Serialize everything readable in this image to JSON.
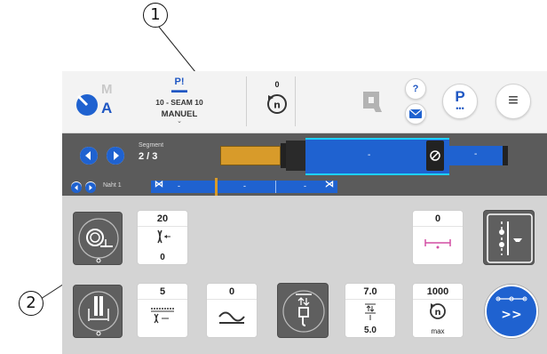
{
  "callouts": {
    "one": "1",
    "two": "2"
  },
  "header": {
    "mode_logo": {
      "big_letter": "A",
      "small_letter": "M"
    },
    "program": {
      "icon_label": "P!",
      "name": "10 - SEAM 10",
      "mode": "MANUEL"
    },
    "counter_value": "0",
    "help_label": "?",
    "p_label": "P",
    "menu_label": "≡"
  },
  "segment_bar": {
    "segment_label": "Segment",
    "segment_value": "2 / 3",
    "seam_label": "Naht 1",
    "segment_dash": "-",
    "right_dash": "-",
    "seam_cells": [
      "-",
      "-",
      "-"
    ]
  },
  "functions": {
    "row1": {
      "tile_a": {
        "top": "20",
        "bottom": "0"
      },
      "tile_b": {
        "top": "0"
      }
    },
    "row2": {
      "tile_c": {
        "top": "5"
      },
      "tile_d": {
        "top": "0"
      },
      "tile_e": {
        "top": "7.0",
        "bottom": "5.0"
      },
      "tile_f": {
        "top": "1000",
        "bottom": "max"
      }
    },
    "go_label": ">>"
  },
  "colors": {
    "accent": "#1f62d0",
    "highlight": "#d89b2a",
    "dark": "#5b5b5b"
  }
}
